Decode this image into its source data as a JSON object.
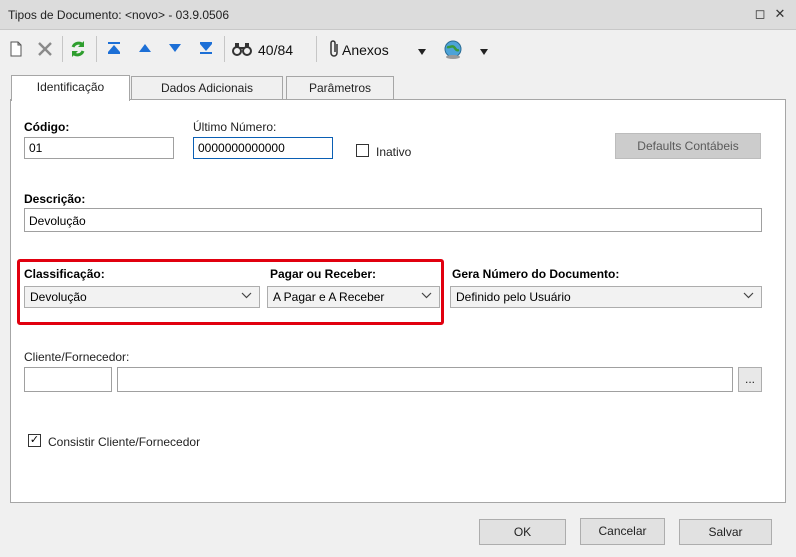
{
  "window": {
    "title": "Tipos de Documento: <novo> - 03.9.0506",
    "restore_glyph": "◻",
    "close_glyph": "✕"
  },
  "toolbar": {
    "record_counter": "40/84",
    "attachments_label": "Anexos",
    "icons": [
      "new-icon",
      "delete-icon",
      "refresh-icon",
      "first-record-icon",
      "previous-record-icon",
      "next-record-icon",
      "last-record-icon",
      "search-binoculars-icon",
      "paperclip-icon",
      "dropdown-arrow-icon",
      "globe-icon",
      "dropdown-arrow-icon"
    ]
  },
  "tabs": [
    {
      "label": "Identificação",
      "active": true
    },
    {
      "label": "Dados Adicionais",
      "active": false
    },
    {
      "label": "Parâmetros",
      "active": false
    }
  ],
  "form": {
    "codigo": {
      "label": "Código:",
      "value": "01"
    },
    "ultimo_numero": {
      "label": "Último Número:",
      "value": "0000000000000"
    },
    "inativo": {
      "label": "Inativo",
      "checked": false
    },
    "defaults_button": "Defaults Contábeis",
    "descricao": {
      "label": "Descrição:",
      "value": "Devolução"
    },
    "classificacao": {
      "label": "Classificação:",
      "value": "Devolução"
    },
    "pagar_receber": {
      "label": "Pagar ou Receber:",
      "value": "A Pagar e A Receber"
    },
    "gera_numero": {
      "label": "Gera Número do Documento:",
      "value": "Definido pelo Usuário"
    },
    "cliente_fornecedor": {
      "label": "Cliente/Fornecedor:",
      "code": "",
      "name": "",
      "lookup_button": "..."
    },
    "consistir": {
      "label": "Consistir Cliente/Fornecedor",
      "checked": true,
      "check_glyph": "✓"
    }
  },
  "footer": {
    "ok": "OK",
    "cancel": "Cancelar",
    "save": "Salvar"
  },
  "colors": {
    "highlight": "#e1000f",
    "focus_border": "#0a5fb4",
    "refresh_green": "#2e9e2e",
    "nav_blue": "#1c6fd6"
  }
}
